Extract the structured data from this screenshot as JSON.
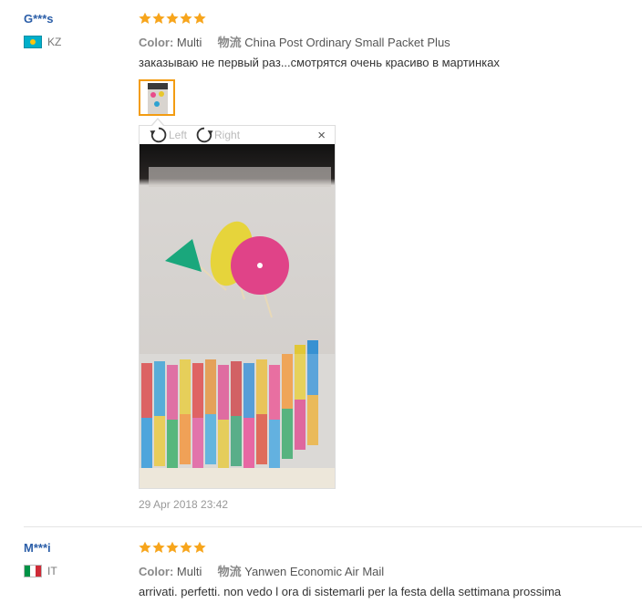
{
  "reviews": [
    {
      "user": "G***s",
      "country": "KZ",
      "rating": 5,
      "color_label": "Color:",
      "color_value": "Multi",
      "shipping_label": "物流",
      "shipping_value": "China Post Ordinary Small Packet Plus",
      "text": "заказываю не первый раз...смотрятся очень красиво в мартинках",
      "viewer": {
        "rotate_left": "Left",
        "rotate_right": "Right",
        "close": "×"
      },
      "date": "29 Apr 2018 23:42"
    },
    {
      "user": "M***i",
      "country": "IT",
      "rating": 5,
      "color_label": "Color:",
      "color_value": "Multi",
      "shipping_label": "物流",
      "shipping_value": "Yanwen Economic Air Mail",
      "text": "arrivati. perfetti. non vedo l ora di sistemarli per la festa della settimana prossima"
    }
  ],
  "colors": {
    "star": "#f7a51c",
    "user_link": "#2b5ea8",
    "thumb_border": "#f39c12"
  }
}
